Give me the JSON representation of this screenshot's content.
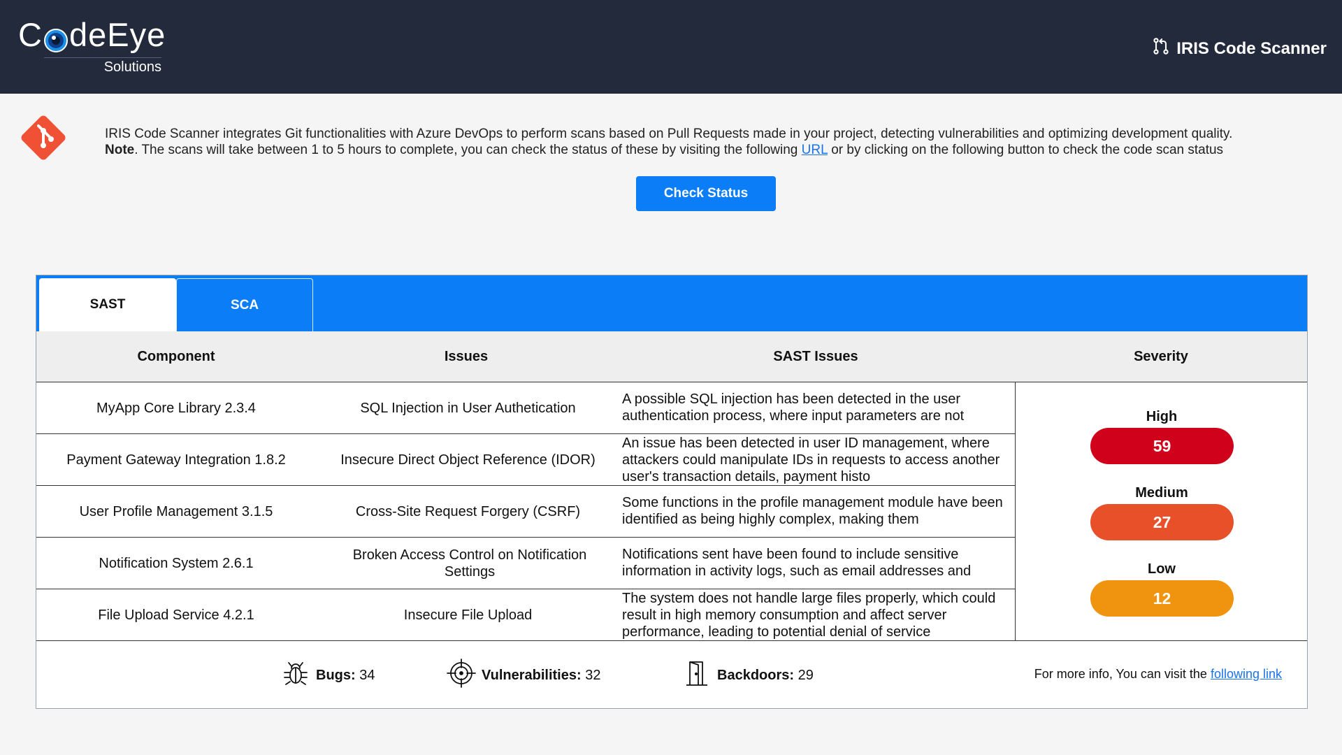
{
  "header": {
    "logo_prefix": "C",
    "logo_suffix": "deEye",
    "logo_sub": "Solutions",
    "app_title": "IRIS Code Scanner",
    "app_icon": "git-pull-request-icon"
  },
  "intro": {
    "line1": "IRIS Code Scanner integrates Git functionalities with Azure DevOps to perform scans based on Pull Requests made in your project, detecting vulnerabilities and optimizing development quality.",
    "note_label": "Note",
    "line2_a": ". The scans will take between 1 to 5 hours to complete, you can check the status of these by visiting the following ",
    "url_label": "URL",
    "line2_b": " or by clicking on the following button to check the code scan status",
    "button_label": "Check Status"
  },
  "tabs": [
    {
      "label": "SAST",
      "active": true
    },
    {
      "label": "SCA",
      "active": false
    }
  ],
  "table": {
    "headers": [
      "Component",
      "Issues",
      "SAST Issues",
      "Severity"
    ],
    "rows": [
      {
        "component": "MyApp Core Library 2.3.4",
        "issue": "SQL Injection in User Authetication",
        "description": "A possible SQL injection has been detected in the user authentication process, where input parameters are not"
      },
      {
        "component": "Payment Gateway Integration 1.8.2",
        "issue": "Insecure Direct Object Reference (IDOR)",
        "description": "An issue has been detected in user ID management, where attackers could manipulate IDs in requests to access another user's transaction details, payment histo"
      },
      {
        "component": "User Profile Management 3.1.5",
        "issue": "Cross-Site Request Forgery (CSRF)",
        "description": "Some functions in the profile management module have been identified as being highly complex, making them"
      },
      {
        "component": "Notification System 2.6.1",
        "issue": "Broken Access Control on Notification Settings",
        "description": "Notifications sent have been found to include sensitive information in activity logs, such as email addresses and"
      },
      {
        "component": "File Upload Service 4.2.1",
        "issue": "Insecure File Upload",
        "description": "The system does not handle large files properly, which could result in high memory consumption and affect server performance, leading to potential denial of service"
      }
    ]
  },
  "severity": [
    {
      "label": "High",
      "count": "59",
      "color": "#d0021b"
    },
    {
      "label": "Medium",
      "count": "27",
      "color": "#e8502a"
    },
    {
      "label": "Low",
      "count": "12",
      "color": "#f0930f"
    }
  ],
  "footer": {
    "bugs_label": "Bugs:",
    "bugs_value": "34",
    "bugs_icon": "bug-icon",
    "vulns_label": "Vulnerabilities:",
    "vulns_value": "32",
    "vulns_icon": "crosshair-icon",
    "backdoors_label": "Backdoors:",
    "backdoors_value": "29",
    "backdoors_icon": "door-icon",
    "more_text": "For more info, You can visit the ",
    "more_link": "following link"
  },
  "colors": {
    "header_bg": "#222a3c",
    "accent": "#0a7df7",
    "git_orange": "#f05033"
  }
}
